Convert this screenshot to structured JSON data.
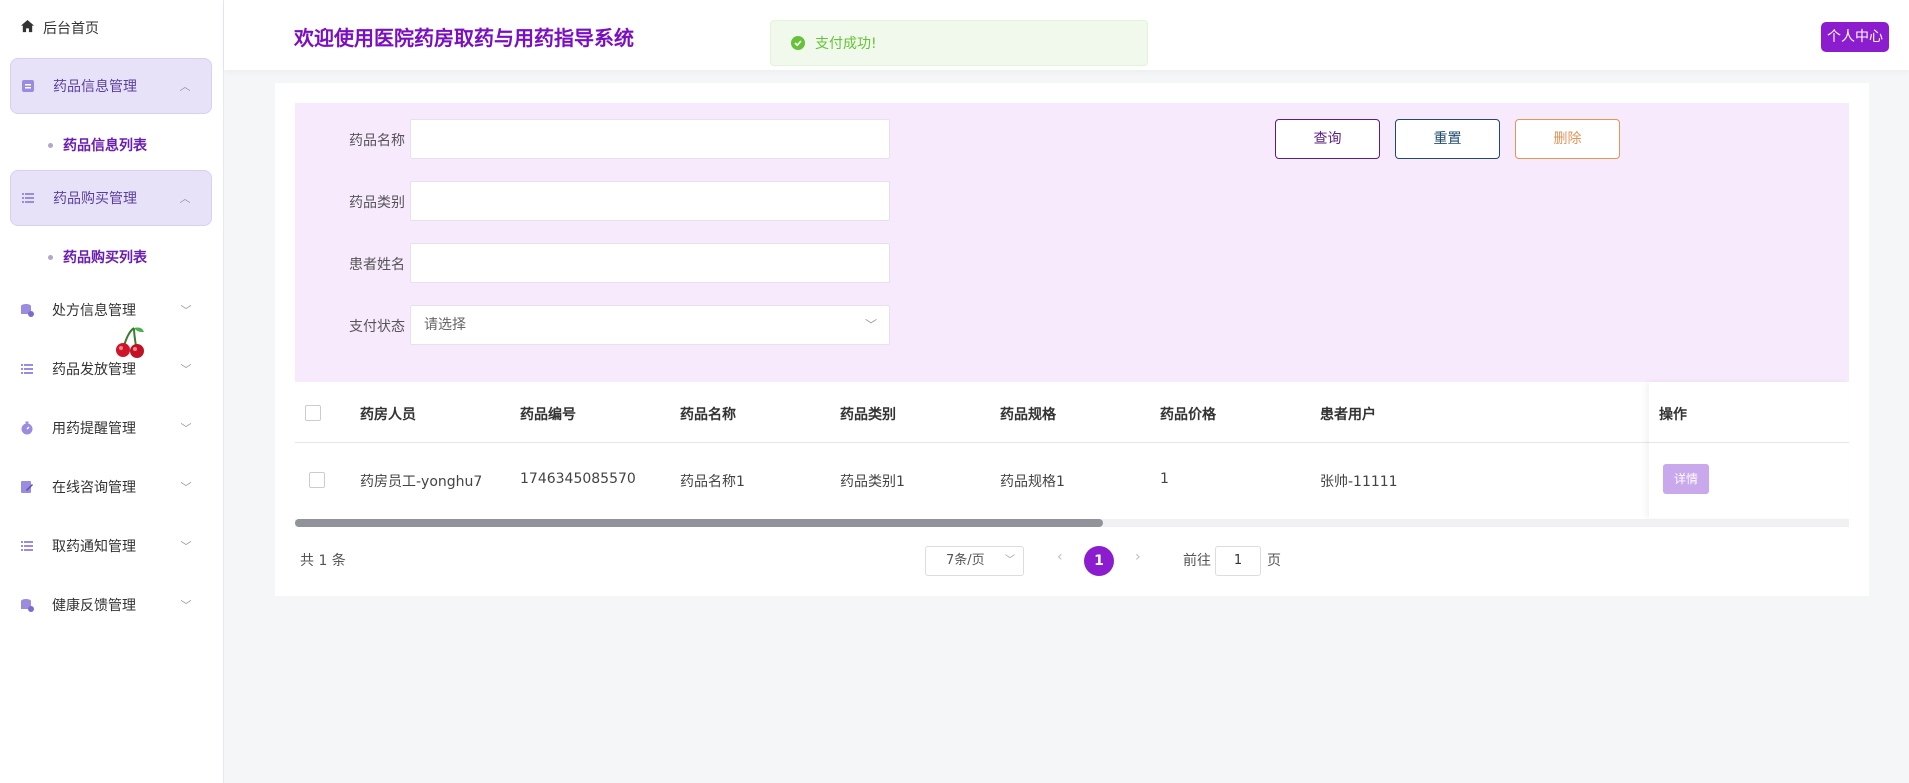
{
  "sidebar": {
    "home_label": "后台首页",
    "groups": [
      {
        "label": "药品信息管理",
        "sub": "药品信息列表"
      },
      {
        "label": "药品购买管理",
        "sub": "药品购买列表"
      },
      {
        "label": "处方信息管理"
      },
      {
        "label": "药品发放管理"
      },
      {
        "label": "用药提醒管理"
      },
      {
        "label": "在线咨询管理"
      },
      {
        "label": "取药通知管理"
      },
      {
        "label": "健康反馈管理"
      }
    ]
  },
  "header": {
    "title": "欢迎使用医院药房取药与用药指导系统",
    "user_button": "个人中心"
  },
  "toast": {
    "message": "支付成功!"
  },
  "search": {
    "drug_name_label": "药品名称",
    "drug_category_label": "药品类别",
    "patient_name_label": "患者姓名",
    "pay_status_label": "支付状态",
    "pay_status_placeholder": "请选择",
    "query_button": "查询",
    "reset_button": "重置",
    "delete_button": "删除"
  },
  "table": {
    "headers": [
      "药房人员",
      "药品编号",
      "药品名称",
      "药品类别",
      "药品规格",
      "药品价格",
      "患者用户",
      "操作"
    ],
    "rows": [
      [
        "药房员工-yonghu7",
        "1746345085570",
        "药品名称1",
        "药品类别1",
        "药品规格1",
        "1",
        "张帅-11111"
      ]
    ],
    "detail_button": "详情"
  },
  "pagination": {
    "total": "共 1 条",
    "page_size": "7条/页",
    "current_page": "1",
    "goto_prefix": "前往",
    "goto_value": "1",
    "goto_suffix": "页",
    "scroll_fraction": 0.52
  },
  "colors": {
    "brand": "#8b1dcf",
    "title": "#7a0fc2",
    "panel_bg": "#f7eafd",
    "success": "#67c23a"
  }
}
